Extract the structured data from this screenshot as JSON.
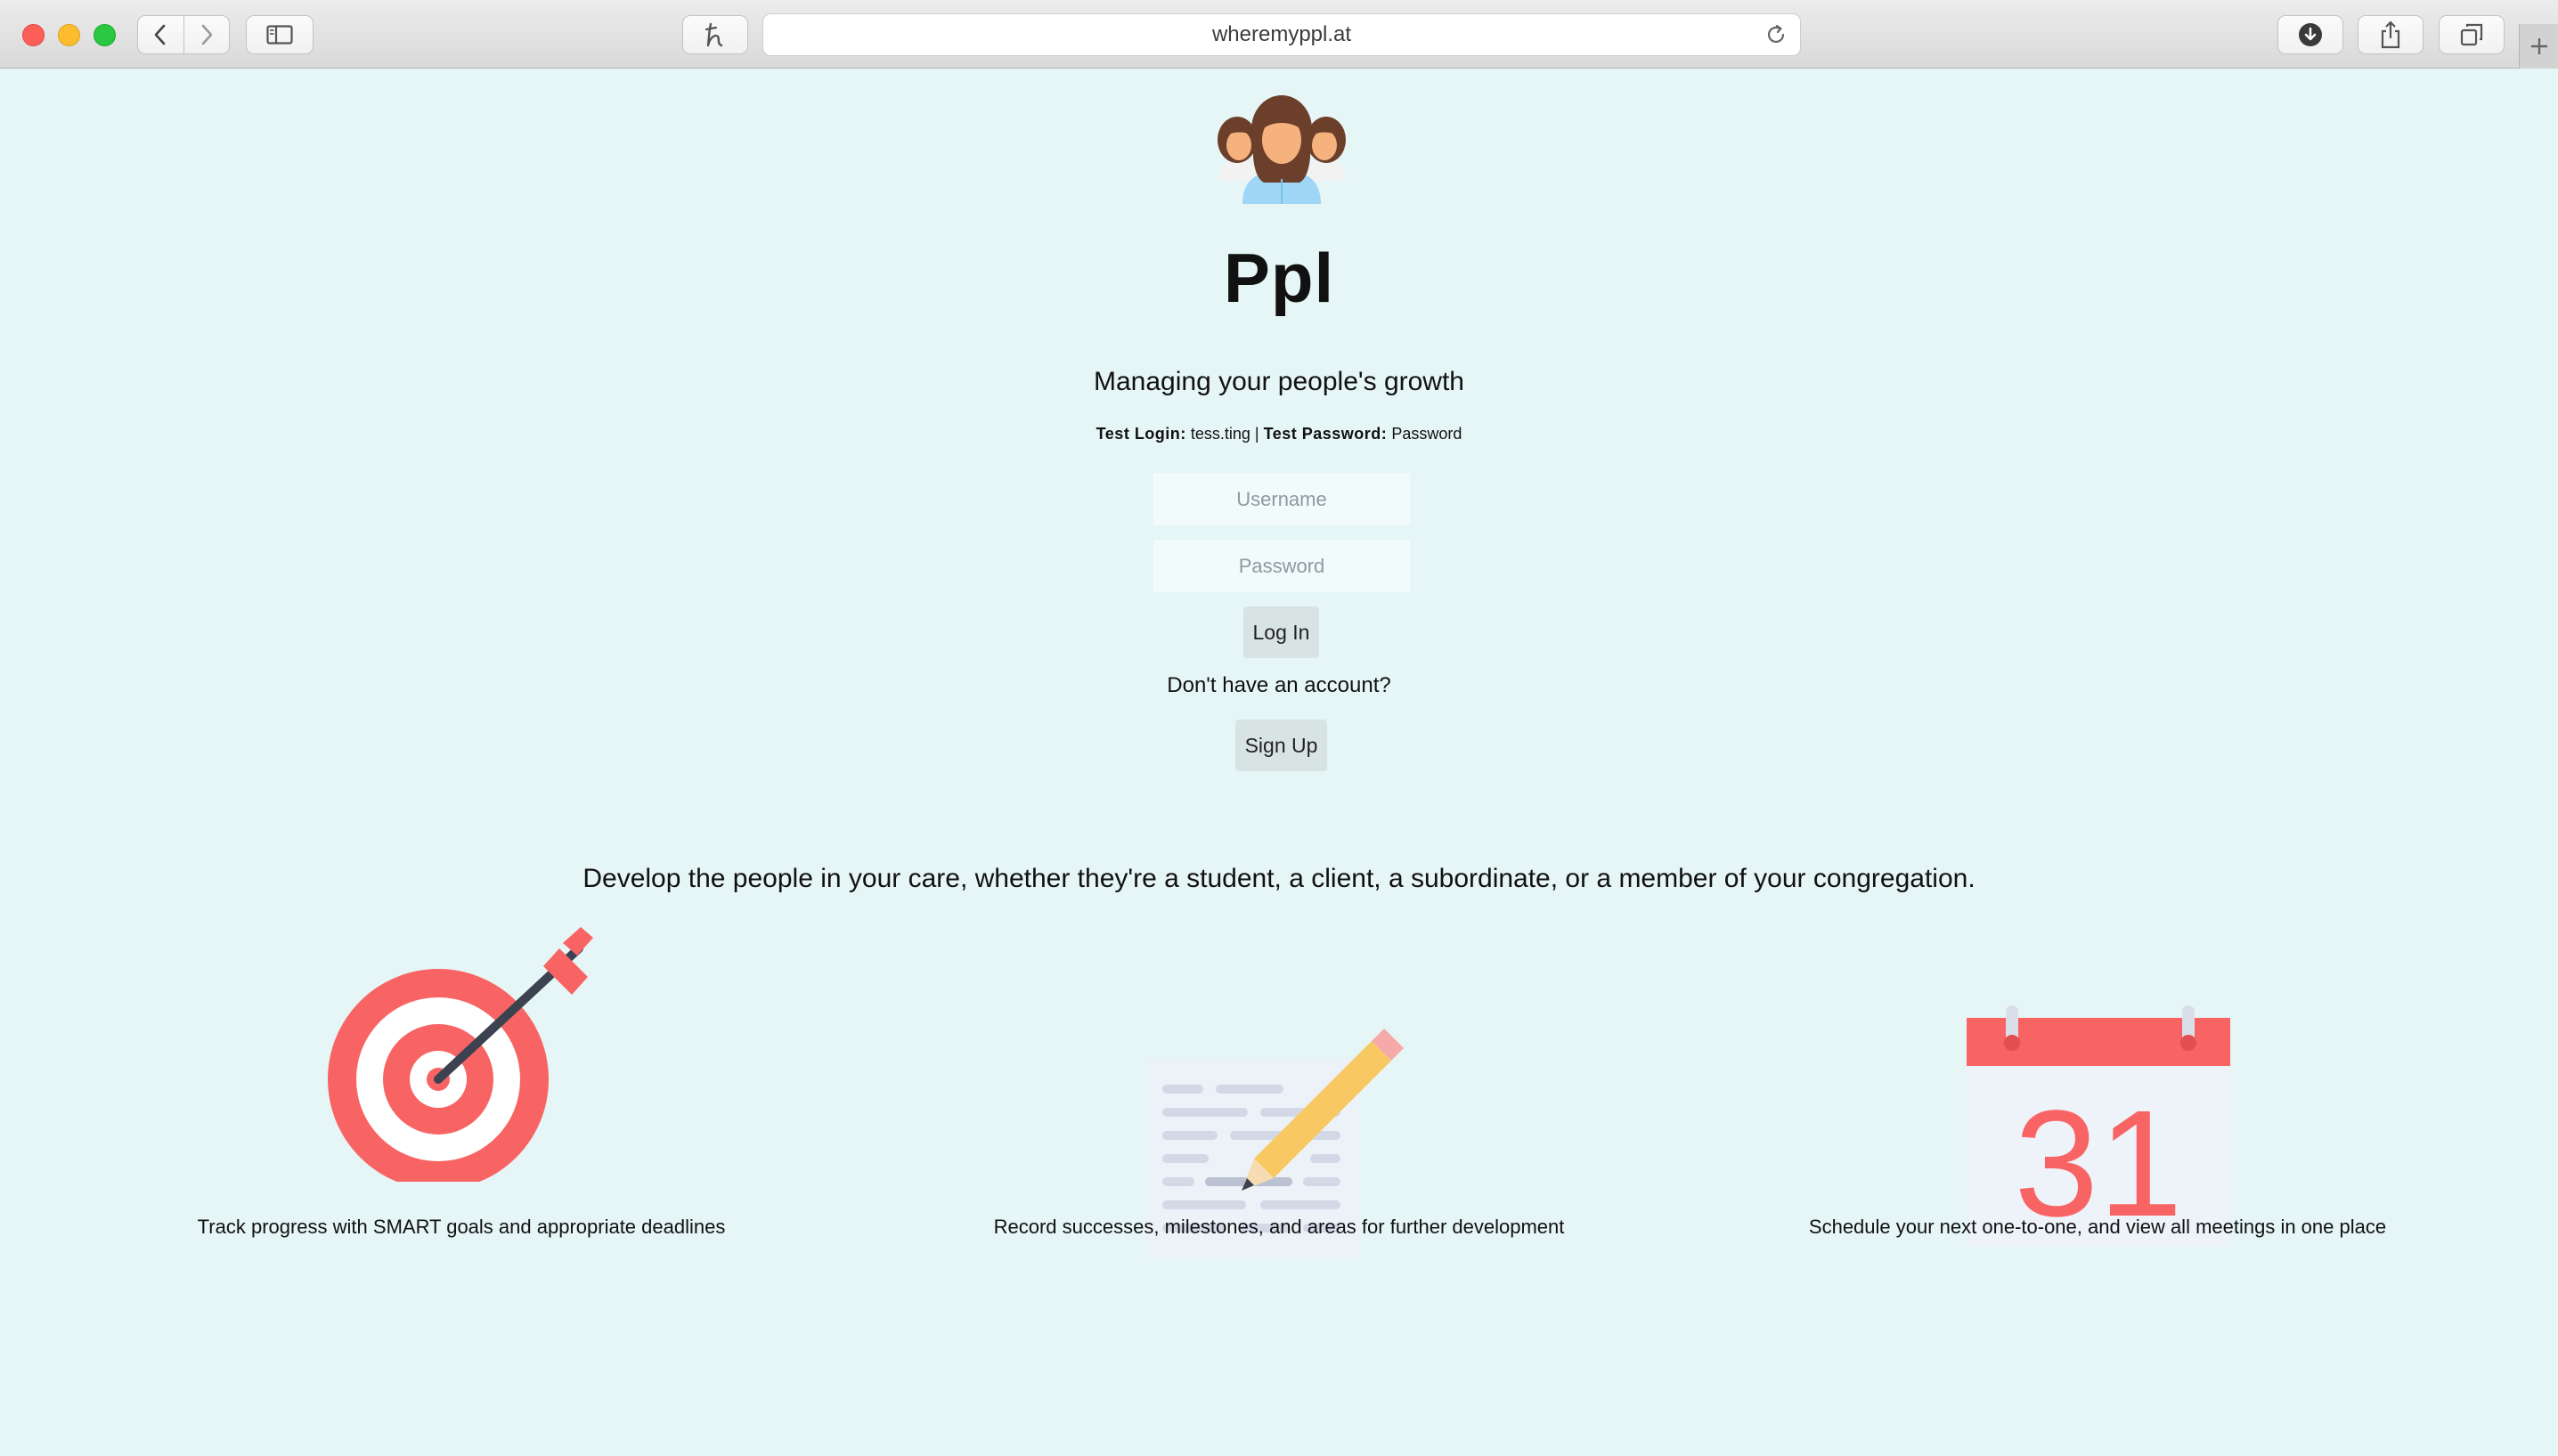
{
  "browser": {
    "url": "wheremyppl.at",
    "icons": {
      "back": "chevron-left-icon",
      "forward": "chevron-right-icon",
      "sidebar": "sidebar-icon",
      "extension": "honey-extension-icon",
      "reload": "reload-icon",
      "downloads": "download-icon",
      "share": "share-icon",
      "tabs": "tabs-overview-icon",
      "new_tab": "plus-icon"
    }
  },
  "header": {
    "logo": "people-group-logo",
    "title": "Ppl",
    "tagline": "Managing your people's growth",
    "credentials": {
      "login_label": "Test Login:",
      "login_value": "tess.ting",
      "separator": "|",
      "password_label": "Test Password:",
      "password_value": "Password"
    }
  },
  "form": {
    "username_placeholder": "Username",
    "password_placeholder": "Password",
    "login_label": "Log In",
    "no_account_text": "Don't have an account?",
    "signup_label": "Sign Up"
  },
  "features": {
    "intro": "Develop the people in your care, whether they're a student, a client, a subordinate, or a member of your congregation.",
    "items": [
      {
        "icon": "target-arrow-icon",
        "caption": "Track progress with SMART goals and appropriate deadlines"
      },
      {
        "icon": "document-pencil-icon",
        "caption": "Record successes, milestones, and areas for further development"
      },
      {
        "icon": "calendar-icon",
        "caption": "Schedule your next one-to-one, and view all meetings in one place",
        "calendar_day": "31"
      }
    ]
  },
  "colors": {
    "page_background": "#e6f5f5",
    "accent_red": "#f86464",
    "button_background": "#d8e4e4",
    "input_background": "#f2fbfb"
  }
}
